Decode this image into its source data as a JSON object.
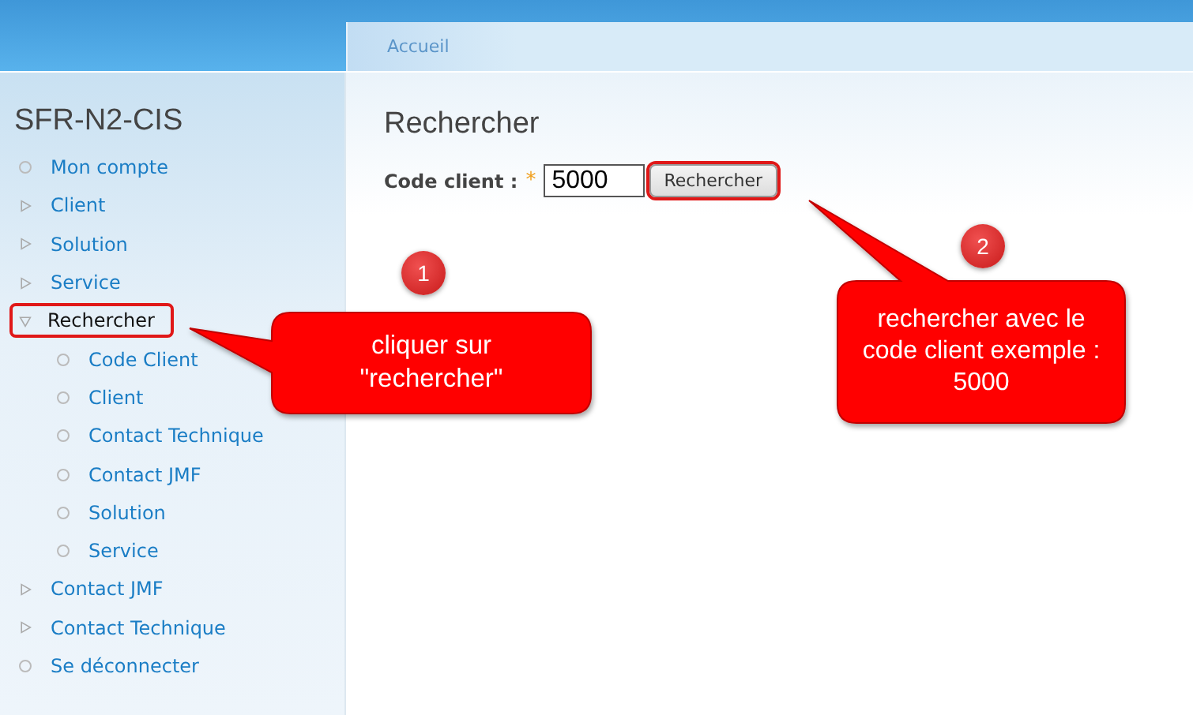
{
  "breadcrumb": "Accueil",
  "site_title": "SFR-N2-CIS",
  "menu": [
    {
      "label": "Mon compte",
      "kind": "leaf",
      "highlighted": false
    },
    {
      "label": "Client",
      "kind": "branch",
      "expanded": false,
      "highlighted": false
    },
    {
      "label": "Solution",
      "kind": "branch",
      "expanded": false,
      "highlighted": false
    },
    {
      "label": "Service",
      "kind": "branch",
      "expanded": false,
      "highlighted": false
    },
    {
      "label": "Rechercher",
      "kind": "branch",
      "expanded": true,
      "highlighted": true,
      "children": [
        {
          "label": "Code Client",
          "kind": "leaf",
          "highlighted": false
        },
        {
          "label": "Client",
          "kind": "leaf",
          "highlighted": false
        },
        {
          "label": "Contact Technique",
          "kind": "leaf",
          "highlighted": false
        },
        {
          "label": "Contact JMF",
          "kind": "leaf",
          "highlighted": false
        },
        {
          "label": "Solution",
          "kind": "leaf",
          "highlighted": false
        },
        {
          "label": "Service",
          "kind": "leaf",
          "highlighted": false
        }
      ]
    },
    {
      "label": "Contact JMF",
      "kind": "branch",
      "expanded": false,
      "highlighted": false
    },
    {
      "label": "Contact Technique",
      "kind": "branch",
      "expanded": false,
      "highlighted": false
    },
    {
      "label": "Se déconnecter",
      "kind": "leaf",
      "highlighted": false
    }
  ],
  "page_title": "Rechercher",
  "form": {
    "label": "Code client :",
    "required_mark": "*",
    "value": "5000",
    "button": "Rechercher",
    "button_highlighted": true
  },
  "callouts": [
    {
      "number": "1",
      "text": "cliquer sur \"rechercher\""
    },
    {
      "number": "2",
      "text": "rechercher avec le code client exemple : 5000"
    }
  ]
}
